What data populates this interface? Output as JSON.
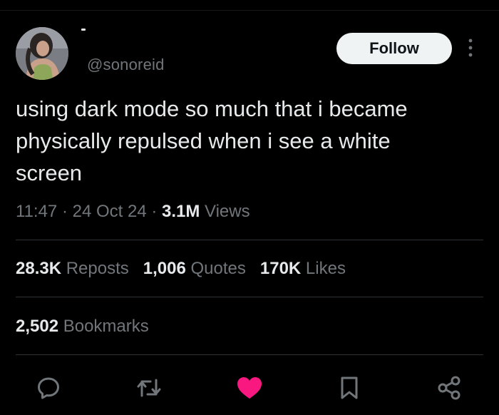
{
  "author": {
    "handle": "@sonoreid",
    "display_name_mark": "-"
  },
  "follow_button": {
    "label": "Follow"
  },
  "tweet": {
    "text_lines": [
      "using dark mode so much that i became",
      "physically repulsed when i see a white",
      "screen"
    ]
  },
  "meta": {
    "time": "11:47",
    "sep1": " · ",
    "date": "24 Oct 24",
    "sep2": " · ",
    "views_count": "3.1M",
    "views_label": " Views"
  },
  "stats": {
    "reposts_count": "28.3K",
    "reposts_label": " Reposts",
    "quotes_count": "1,006",
    "quotes_label": " Quotes",
    "likes_count": "170K",
    "likes_label": " Likes",
    "bookmarks_count": "2,502",
    "bookmarks_label": " Bookmarks"
  },
  "actions": {
    "icons": [
      "reply-icon",
      "repost-icon",
      "like-icon",
      "bookmark-icon",
      "share-icon"
    ],
    "like_color": "#f91880",
    "icon_color": "#71767b"
  },
  "colors": {
    "background": "#000000",
    "text_primary": "#e7e9ea",
    "text_secondary": "#71767b",
    "divider": "#2f3336",
    "follow_bg": "#eff3f4"
  }
}
